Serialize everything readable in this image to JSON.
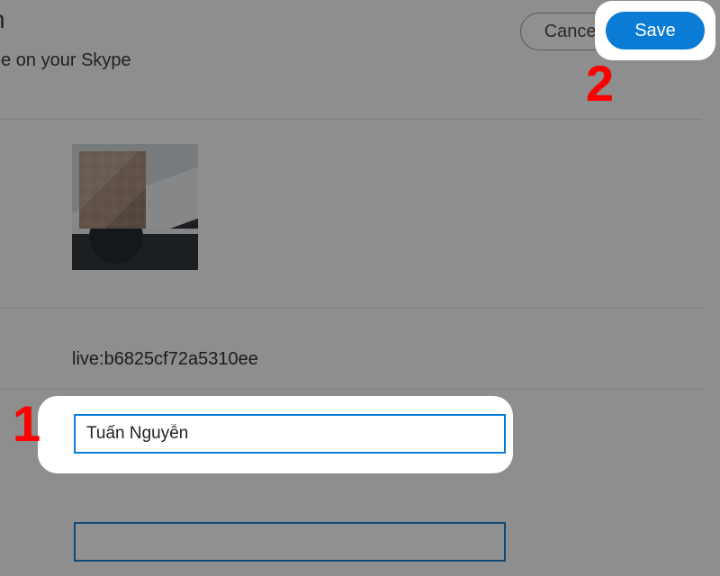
{
  "header": {
    "title_fragment": "n",
    "subtitle_fragment": "ee on your Skype"
  },
  "buttons": {
    "cancel": "Cancel",
    "save": "Save"
  },
  "profile": {
    "skype_id": "live:b6825cf72a5310ee",
    "display_name": "Tuấn Nguyễn",
    "secondary_value": ""
  },
  "annotations": {
    "step1": "1",
    "step2": "2"
  }
}
